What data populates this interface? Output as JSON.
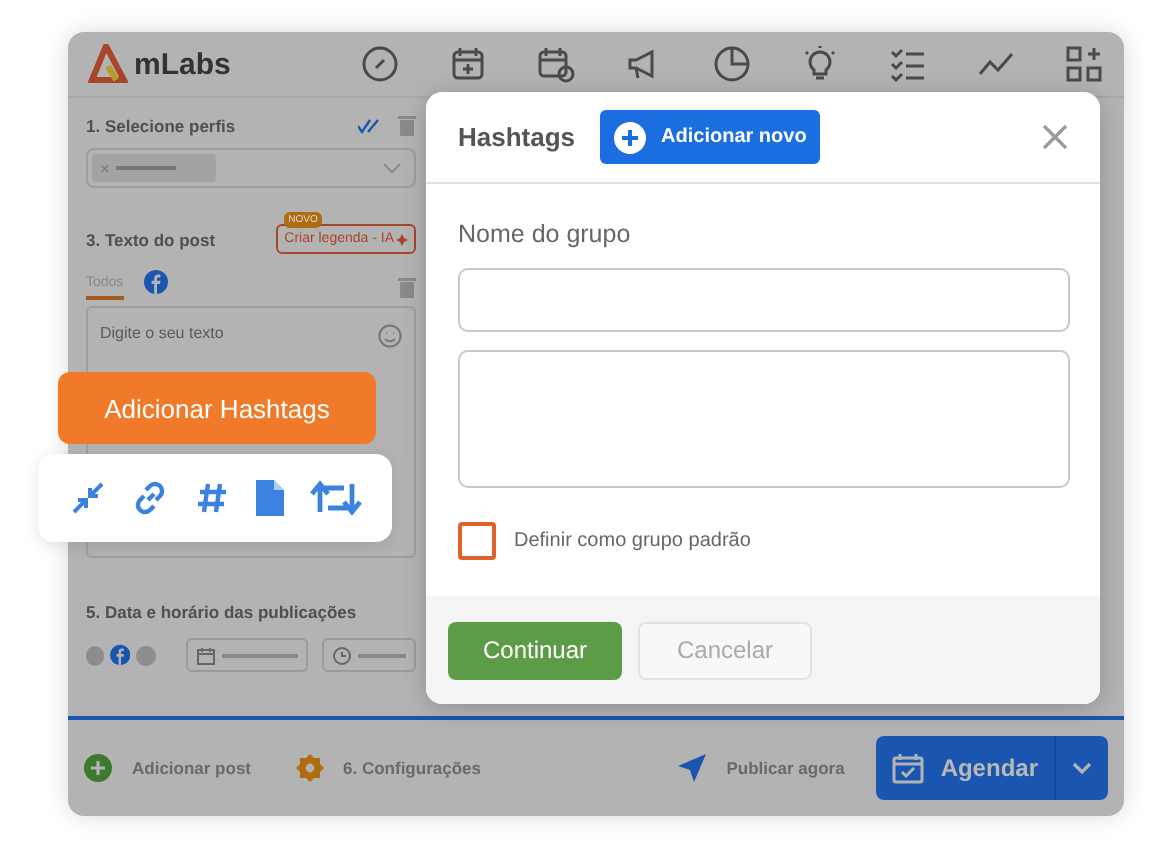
{
  "app": {
    "logo": "mLabs"
  },
  "profiles": {
    "title": "1. Selecione perfis",
    "chip": "×"
  },
  "post_text": {
    "title": "3. Texto do post",
    "badge": "NOVO",
    "ai_button": "Criar legenda - IA",
    "tabs": [
      {
        "kind": "text",
        "label": "Todos",
        "selected": true
      },
      {
        "kind": "facebook",
        "selected": false
      }
    ],
    "placeholder": "Digite o seu texto"
  },
  "tooltip": "Adicionar Hashtags",
  "schedule_section": {
    "title": "5. Data e horário das publicações"
  },
  "footer": {
    "add_post": "Adicionar post",
    "settings": "6. Configurações",
    "publish_now": "Publicar agora",
    "schedule": "Agendar"
  },
  "modal": {
    "title": "Hashtags",
    "add_button": "Adicionar novo",
    "group_label": "Nome do grupo",
    "default_checkbox": {
      "label": "Definir como grupo padrão",
      "checked": false
    },
    "buttons": [
      {
        "kind": "primary",
        "label": "Continuar"
      },
      {
        "kind": "secondary",
        "label": "Cancelar"
      }
    ]
  }
}
